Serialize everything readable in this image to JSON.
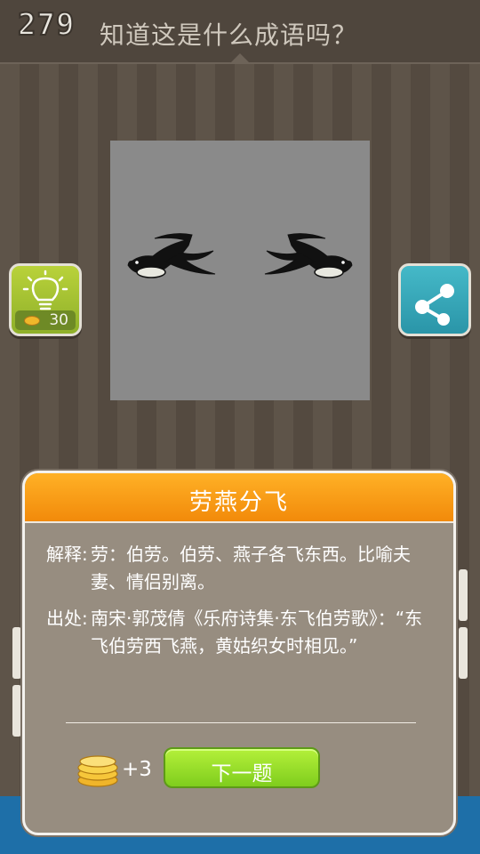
{
  "header": {
    "level": "279",
    "question": "知道这是什么成语吗？"
  },
  "hint": {
    "cost": "30",
    "icon": "lightbulb-icon"
  },
  "share": {
    "icon": "share-icon"
  },
  "puzzle": {
    "image": "two-swallows-flying-apart"
  },
  "dialog": {
    "title": "劳燕分飞",
    "definition_label": "解释:",
    "definition_text": "劳：伯劳。伯劳、燕子各飞东西。比喻夫妻、情侣别离。",
    "source_label": "出处:",
    "source_text": "南宋·郭茂倩《乐府诗集·东飞伯劳歌》：“东飞伯劳西飞燕，黄姑织女时相见。”",
    "reward": "+3",
    "next_label": "下一题"
  },
  "colors": {
    "title_bar": "#f28a0a",
    "next_button": "#8fdc26",
    "hint_button": "#a6c232",
    "share_button": "#35a8b9"
  }
}
